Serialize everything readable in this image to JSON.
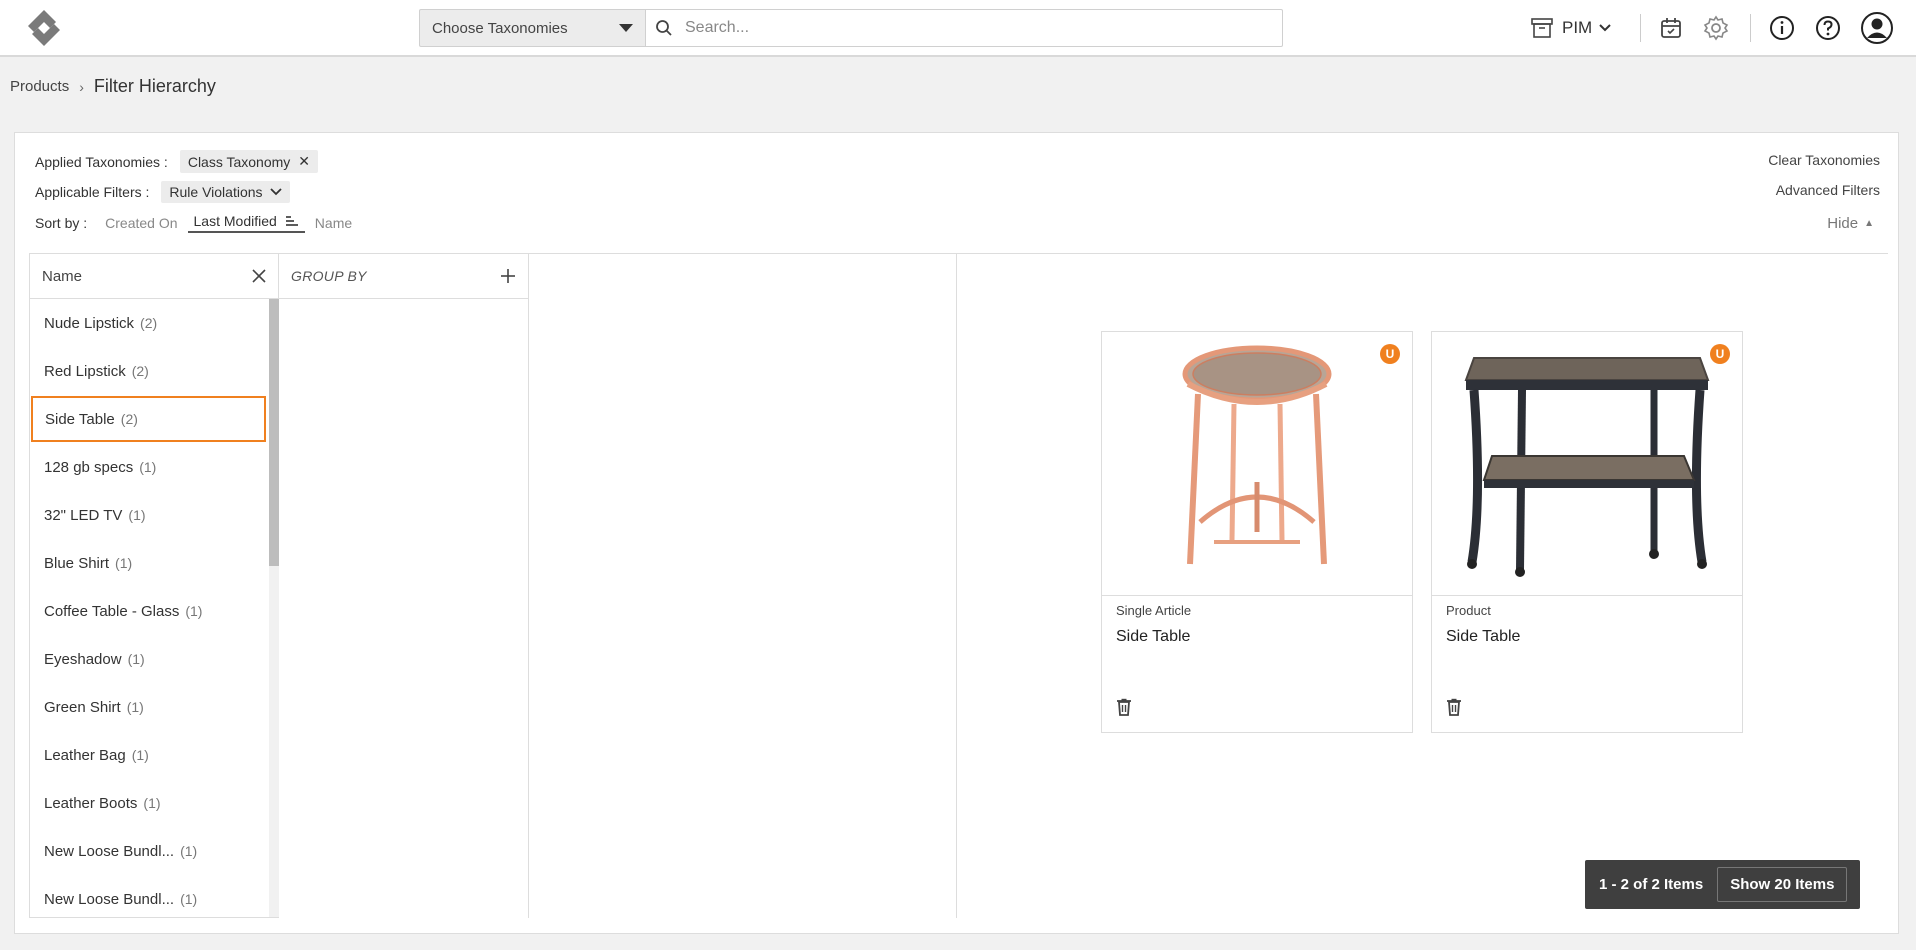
{
  "header": {
    "taxonomy_select": "Choose Taxonomies",
    "search_placeholder": "Search...",
    "module": "PIM"
  },
  "breadcrumb": {
    "parent": "Products",
    "current": "Filter Hierarchy"
  },
  "filters": {
    "applied_label": "Applied Taxonomies :",
    "applied_chip": "Class Taxonomy",
    "applicable_label": "Applicable Filters :",
    "applicable_chip": "Rule Violations",
    "sort_label": "Sort by :",
    "sort_options": [
      "Created On",
      "Last Modified",
      "Name"
    ],
    "clear_link": "Clear Taxonomies",
    "advanced_link": "Advanced Filters",
    "hide_link": "Hide"
  },
  "hierarchy": {
    "name_header": "Name",
    "group_by_header": "GROUP BY",
    "items": [
      {
        "label": "Nude Lipstick",
        "count": "(2)"
      },
      {
        "label": "Red Lipstick",
        "count": "(2)"
      },
      {
        "label": "Side Table",
        "count": "(2)"
      },
      {
        "label": "128 gb specs",
        "count": "(1)"
      },
      {
        "label": "32\" LED TV",
        "count": "(1)"
      },
      {
        "label": "Blue Shirt",
        "count": "(1)"
      },
      {
        "label": "Coffee Table - Glass",
        "count": "(1)"
      },
      {
        "label": "Eyeshadow",
        "count": "(1)"
      },
      {
        "label": "Green Shirt",
        "count": "(1)"
      },
      {
        "label": "Leather Bag",
        "count": "(1)"
      },
      {
        "label": "Leather Boots",
        "count": "(1)"
      },
      {
        "label": "New Loose Bundl...",
        "count": "(1)"
      },
      {
        "label": "New Loose Bundl...",
        "count": "(1)"
      }
    ]
  },
  "cards": [
    {
      "badge": "U",
      "type": "Single Article",
      "name": "Side Table"
    },
    {
      "badge": "U",
      "type": "Product",
      "name": "Side Table"
    }
  ],
  "pager": {
    "count": "1 - 2 of 2 Items",
    "show": "Show 20 Items"
  },
  "colors": {
    "accent": "#f0801f",
    "pager_bg": "#3f3f3f"
  }
}
